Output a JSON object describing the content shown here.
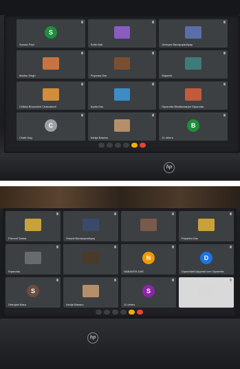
{
  "top_photo": {
    "tiles": [
      {
        "name": "Suman Paul",
        "avatar_letter": "S",
        "avatar_color": "#1e8e3e"
      },
      {
        "name": "Sofia Nah",
        "avatar_letter": "",
        "avatar_color": "#8a5cc2"
      },
      {
        "name": "Sreeyee Bandyopadhyay",
        "avatar_letter": "",
        "avatar_color": "#5b6ea8"
      },
      {
        "name": "Madhu Singh",
        "avatar_letter": "",
        "avatar_color": "#c7743f"
      },
      {
        "name": "Priyanka Das",
        "avatar_letter": "",
        "avatar_color": "#7a4f2f"
      },
      {
        "name": "Rajarshi",
        "avatar_letter": "",
        "avatar_color": "#3f7a7a"
      },
      {
        "name": "Chitrita Bhowmick Chakraborti",
        "avatar_letter": "",
        "avatar_color": "#d28c3c"
      },
      {
        "name": "Arpita Das",
        "avatar_letter": "",
        "avatar_color": "#3c8dc7"
      },
      {
        "name": "Dipannita Bhattacharjee Dipannita",
        "avatar_letter": "",
        "avatar_color": "#c25a3c"
      },
      {
        "name": "Chaiti Nag",
        "avatar_letter": "C",
        "avatar_color": "#9aa0a6"
      },
      {
        "name": "Ashija Basanu",
        "avatar_letter": "",
        "avatar_color": "#b58f6a"
      },
      {
        "name": "11 others",
        "avatar_letter": "B",
        "avatar_color": "#1e8e3e"
      }
    ]
  },
  "bottom_photo": {
    "tiles": [
      {
        "name": "Paromit Sarkar",
        "avatar_letter": "",
        "avatar_color": "#c9a13a"
      },
      {
        "name": "Sreyoti Bandyopadhyay",
        "avatar_letter": "",
        "avatar_color": "#3a4a6a"
      },
      {
        "name": "",
        "avatar_letter": "",
        "avatar_color": "#7a5a4a"
      },
      {
        "name": "Priyanka Das",
        "avatar_letter": "",
        "avatar_color": "#c9a13a"
      },
      {
        "name": "Ripannita",
        "avatar_letter": "",
        "avatar_color": "#6a6a6a"
      },
      {
        "name": "",
        "avatar_letter": "",
        "avatar_color": "#4a3a2a"
      },
      {
        "name": "NABANITA DAS",
        "avatar_letter": "N",
        "avatar_color": "#f29900"
      },
      {
        "name": "Dipannita91@gmail.com Dipannita",
        "avatar_letter": "D",
        "avatar_color": "#1a73e8"
      },
      {
        "name": "Debojani Basu",
        "avatar_letter": "S",
        "avatar_color": "#6d4c41"
      },
      {
        "name": "Ashija Basanu",
        "avatar_letter": "",
        "avatar_color": "#b58f6a"
      },
      {
        "name": "11 others",
        "avatar_letter": "S",
        "avatar_color": "#8e24aa"
      },
      {
        "name": "",
        "avatar_letter": "",
        "avatar_color": "#d8d8d8"
      }
    ]
  },
  "brand": {
    "logo_text": "hp"
  }
}
